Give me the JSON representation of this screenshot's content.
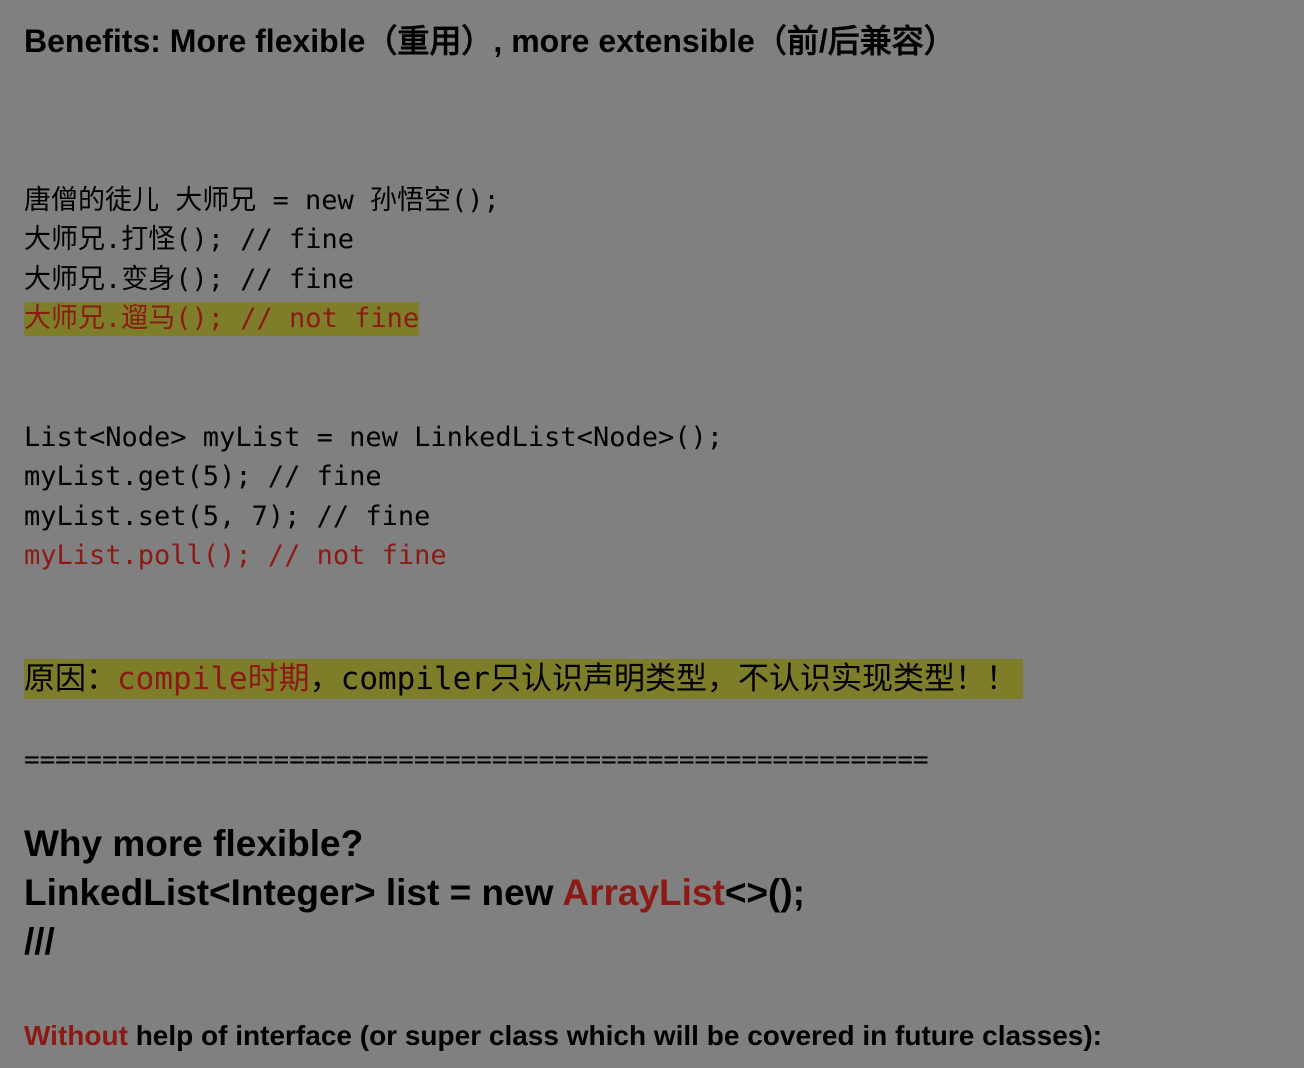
{
  "colors": {
    "background": "#808080",
    "text": "#000000",
    "accent_red": "#8b1a14",
    "highlight": "#7e7e2a"
  },
  "title": "Benefits: More flexible（重用）, more extensible（前/后兼容）",
  "block1": {
    "line1": "唐僧的徒儿 大师兄 = new 孙悟空();",
    "line2": "大师兄.打怪(); // fine",
    "line3": "大师兄.变身(); // fine",
    "line4": "大师兄.遛马(); // not fine"
  },
  "block2": {
    "line1": "List<Node> myList = new LinkedList<Node>();",
    "line2": "myList.get(5); // fine",
    "line3": "myList.set(5, 7); // fine",
    "line4": "myList.poll(); // not fine"
  },
  "reason": {
    "prefix": "原因：",
    "red_part": "compile时期",
    "suffix": "，compiler只认识声明类型，不认识实现类型！！"
  },
  "divider": "==========================================================",
  "why": {
    "heading": "Why more flexible?",
    "code_before": "LinkedList<Integer> list = new ",
    "code_red": "ArrayList",
    "code_after": "<>();",
    "slashes": "///"
  },
  "without": {
    "red_word": "Without",
    "rest": " help of interface (or super class which will be covered in future classes):"
  }
}
